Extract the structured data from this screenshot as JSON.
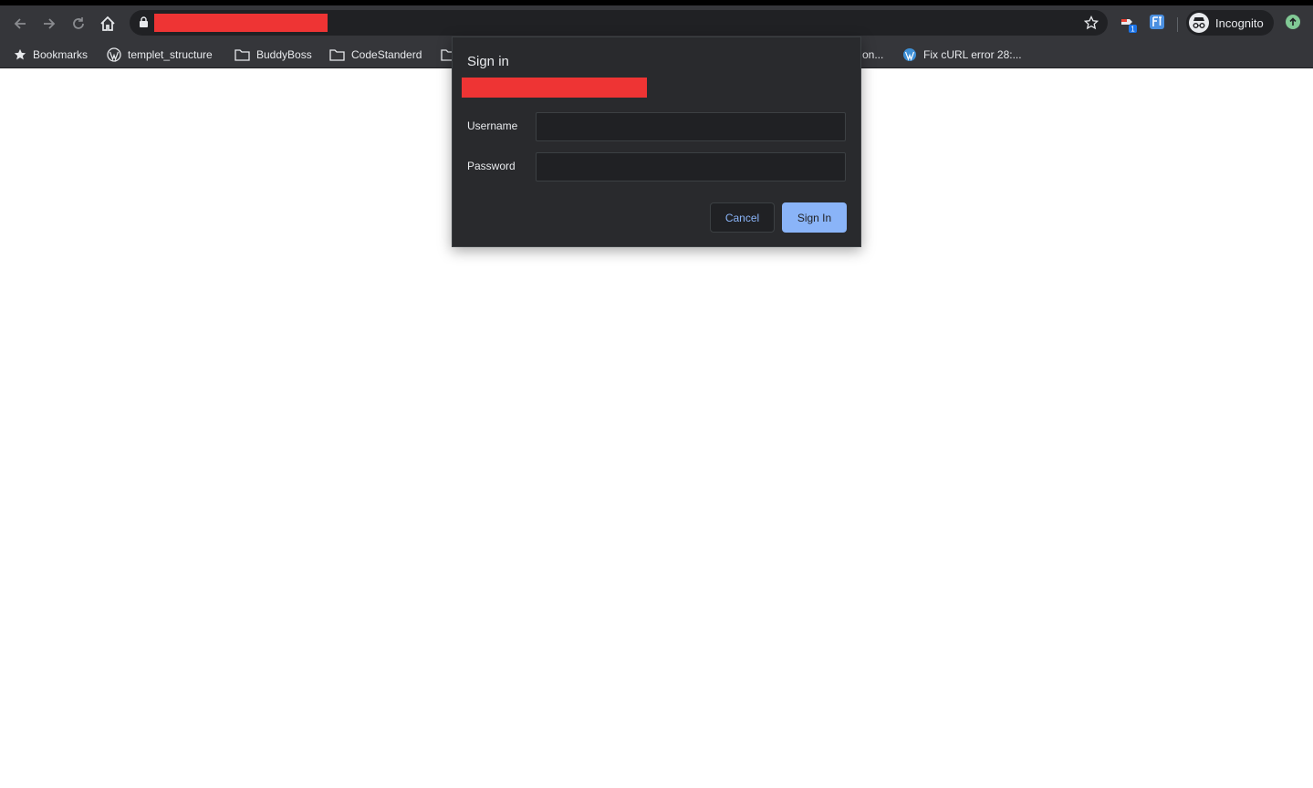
{
  "browser": {
    "profile_label": "Incognito",
    "bookmarks": [
      {
        "label": "Bookmarks",
        "icon": "star-icon"
      },
      {
        "label": "templet_structure",
        "icon": "wordpress-icon"
      },
      {
        "label": "BuddyBoss",
        "icon": "folder-icon"
      },
      {
        "label": "CodeStanderd",
        "icon": "folder-icon"
      },
      {
        "label": "on...",
        "icon": "folder-icon"
      },
      {
        "label": "Fix cURL error 28:...",
        "icon": "wordpress-icon"
      }
    ],
    "extension_badge": "1"
  },
  "dialog": {
    "title": "Sign in",
    "username_label": "Username",
    "password_label": "Password",
    "username_value": "",
    "password_value": "",
    "cancel_label": "Cancel",
    "signin_label": "Sign In"
  },
  "colors": {
    "toolbar": "#35363a",
    "omnibox": "#202124",
    "dialog_bg": "#292a2d",
    "accent": "#8ab4f8",
    "redaction": "#ee3434"
  }
}
